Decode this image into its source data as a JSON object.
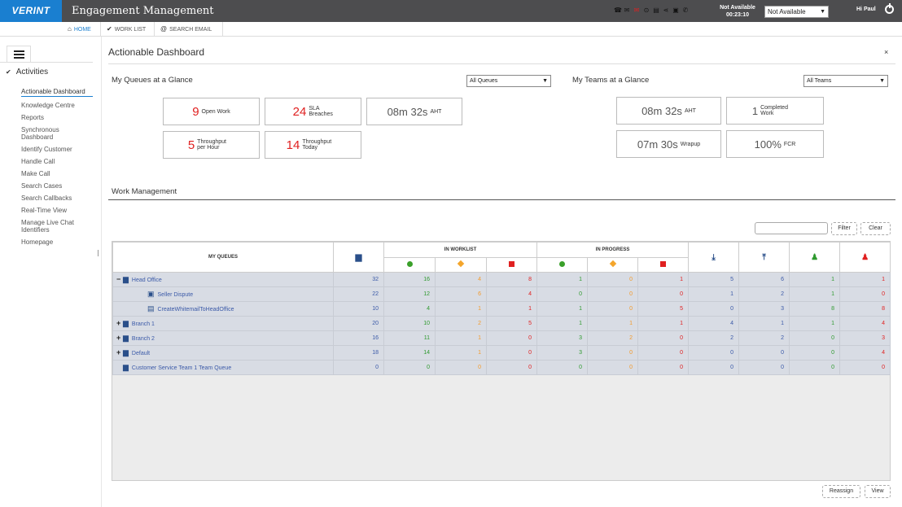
{
  "app": {
    "logo": "VERINT",
    "title": "Engagement Management"
  },
  "status": {
    "label": "Not Available",
    "timer": "00:23:10",
    "select_value": "Not Available",
    "greeting": "Hi Paul"
  },
  "topicons": [
    "phone-icon",
    "chat-icon",
    "email-icon",
    "social-icon",
    "document-icon",
    "share-icon",
    "task-icon",
    "callback-icon"
  ],
  "nav": {
    "tabs": [
      {
        "label": "HOME",
        "icon": "home-icon"
      },
      {
        "label": "WORK LIST",
        "icon": "check-icon"
      },
      {
        "label": "SEARCH EMAIL",
        "icon": "at-icon"
      }
    ]
  },
  "sidebar": {
    "section": "Activities",
    "items": [
      {
        "label": "Actionable Dashboard"
      },
      {
        "label": "Knowledge Centre"
      },
      {
        "label": "Reports"
      },
      {
        "label": "Synchronous Dashboard"
      },
      {
        "label": "Identify Customer"
      },
      {
        "label": "Handle Call"
      },
      {
        "label": "Make Call"
      },
      {
        "label": "Search Cases"
      },
      {
        "label": "Search Callbacks"
      },
      {
        "label": "Real-Time View"
      },
      {
        "label": "Manage Live Chat Identifiers"
      },
      {
        "label": "Homepage"
      }
    ]
  },
  "page": {
    "title": "Actionable Dashboard",
    "close": "×"
  },
  "queues": {
    "heading": "My Queues at a Glance",
    "select": "All Queues",
    "cards": [
      {
        "value": "9",
        "label": "Open Work"
      },
      {
        "value": "24",
        "label": "SLA Breaches"
      },
      {
        "value": "08m 32s",
        "label": "AHT"
      },
      {
        "value": "5",
        "label": "Throughput per Hour"
      },
      {
        "value": "14",
        "label": "Throughput Today"
      }
    ]
  },
  "teams": {
    "heading": "My Teams at a Glance",
    "select": "All Teams",
    "cards": [
      {
        "value": "08m 32s",
        "label": "AHT"
      },
      {
        "value": "1",
        "label": "Completed Work"
      },
      {
        "value": "07m 30s",
        "label": "Wrapup"
      },
      {
        "value": "100%",
        "label": "FCR"
      }
    ]
  },
  "work": {
    "heading": "Work Management",
    "filter_btn": "Filter",
    "clear_btn": "Clear",
    "reassign_btn": "Reassign",
    "view_btn": "View",
    "headers": {
      "queues": "MY QUEUES",
      "in_worklist": "IN WORKLIST",
      "in_progress": "IN PROGRESS"
    },
    "rows": [
      {
        "name": "Head Office",
        "expander": "−",
        "indent": 0,
        "icon": "queue-icon",
        "values": [
          "32",
          "16",
          "4",
          "8",
          "1",
          "0",
          "1",
          "5",
          "6",
          "1",
          "1"
        ]
      },
      {
        "name": "Seller Dispute",
        "expander": "",
        "indent": 1,
        "icon": "case-icon",
        "values": [
          "22",
          "12",
          "6",
          "4",
          "0",
          "0",
          "0",
          "1",
          "2",
          "1",
          "0"
        ]
      },
      {
        "name": "CreateWhitemailToHeadOffice",
        "expander": "",
        "indent": 1,
        "icon": "document-icon",
        "values": [
          "10",
          "4",
          "1",
          "1",
          "1",
          "0",
          "5",
          "0",
          "3",
          "8",
          "8"
        ]
      },
      {
        "name": "Branch 1",
        "expander": "+",
        "indent": 0,
        "icon": "queue-icon",
        "values": [
          "20",
          "10",
          "2",
          "5",
          "1",
          "1",
          "1",
          "4",
          "1",
          "1",
          "4"
        ]
      },
      {
        "name": "Branch 2",
        "expander": "+",
        "indent": 0,
        "icon": "queue-icon",
        "values": [
          "16",
          "11",
          "1",
          "0",
          "3",
          "2",
          "0",
          "2",
          "2",
          "0",
          "3"
        ]
      },
      {
        "name": "Default",
        "expander": "+",
        "indent": 0,
        "icon": "queue-icon",
        "values": [
          "18",
          "14",
          "1",
          "0",
          "3",
          "0",
          "0",
          "0",
          "0",
          "0",
          "4"
        ]
      },
      {
        "name": "Customer Service Team 1 Team Queue",
        "expander": "",
        "indent": 0,
        "icon": "queue-icon",
        "values": [
          "0",
          "0",
          "0",
          "0",
          "0",
          "0",
          "0",
          "0",
          "0",
          "0",
          "0"
        ]
      }
    ]
  }
}
